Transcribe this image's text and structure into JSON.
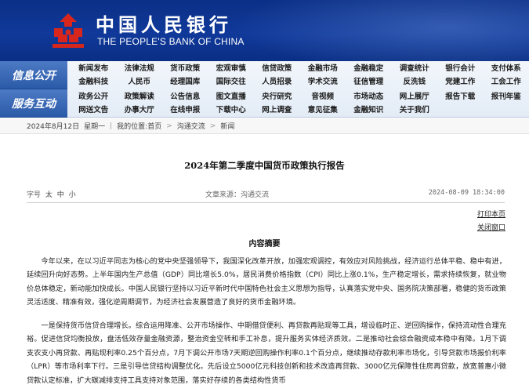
{
  "header": {
    "brand_cn": "中国人民银行",
    "brand_en": "THE PEOPLE'S BANK OF CHINA",
    "colors": {
      "header_bg": "#10399a",
      "logo_red": "#d9261c"
    }
  },
  "nav": {
    "group1_title": "信息公开",
    "group2_title": "服务互动",
    "group1_items": [
      "新闻发布",
      "法律法规",
      "货币政策",
      "宏观审慎",
      "信贷政策",
      "金融市场",
      "金融稳定",
      "调查统计",
      "银行会计",
      "支付体系",
      "金融科技",
      "人民币",
      "经理国库",
      "国际交往",
      "人员招录",
      "学术交流",
      "征信管理",
      "反洗钱",
      "党建工作",
      "工会工作"
    ],
    "group2_items": [
      "政务公开",
      "政策解读",
      "公告信息",
      "图文直播",
      "央行研究",
      "音视频",
      "市场动态",
      "网上展厅",
      "报告下载",
      "报刊年鉴",
      "网送文告",
      "办事大厅",
      "在线申报",
      "下载中心",
      "网上调查",
      "意见征集",
      "金融知识",
      "关于我们"
    ]
  },
  "breadcrumb": {
    "date": "2024年8月12日",
    "weekday": "星期一",
    "prefix": "我的位置:",
    "home": "首页",
    "level1": "沟通交流",
    "level2": "新闻"
  },
  "article": {
    "title": "2024年第二季度中国货币政策执行报告",
    "font_label": "字号",
    "font_sizes": [
      "太",
      "中",
      "小"
    ],
    "source": "文章来源：沟通交流",
    "date": "2024-08-09 18:34:00",
    "print_link": "打印本页",
    "close_link": "关闭窗口",
    "section_head": "内容摘要",
    "para1": "今年以来，在以习近平同志为核心的党中央坚强领导下，我国深化改革开放，加强宏观调控，有效应对风险挑战，经济运行总体平稳、稳中有进，延续回升向好态势。上半年国内生产总值（GDP）同比增长5.0%，居民消费价格指数（CPI）同比上涨0.1%，生产稳定增长，需求持续恢复，就业物价总体稳定，新动能加快成长。中国人民银行坚持以习近平新时代中国特色社会主义思想为指导，认真落实党中央、国务院决策部署，稳健的货币政策灵活适度、精准有效，强化逆周期调节，为经济社会发展营造了良好的货币金融环境。",
    "para2": "一是保持货币信贷合理增长。综合运用降准、公开市场操作、中期借贷便利、再贷款再贴现等工具，增设临时正、逆回购操作，保持流动性合理充裕。促进信贷均衡投放，盘活低效存量金融资源，整治资金空转和手工补息，提升服务实体经济质效。二是推动社会综合融资成本稳中有降。1月下调支农支小再贷款、再贴现利率0.25个百分点，7月下调公开市场7天期逆回购操作利率0.1个百分点，继续推动存款利率市场化，引导贷款市场报价利率（LPR）等市场利率下行。三是引导信贷结构调整优化。先后设立5000亿元科技创新和技术改造再贷款、3000亿元保障性住房再贷款，放宽普惠小微贷款认定标准，扩大碳减排支持工具支持对象范围，落实好存续的各类结构性货币"
  }
}
